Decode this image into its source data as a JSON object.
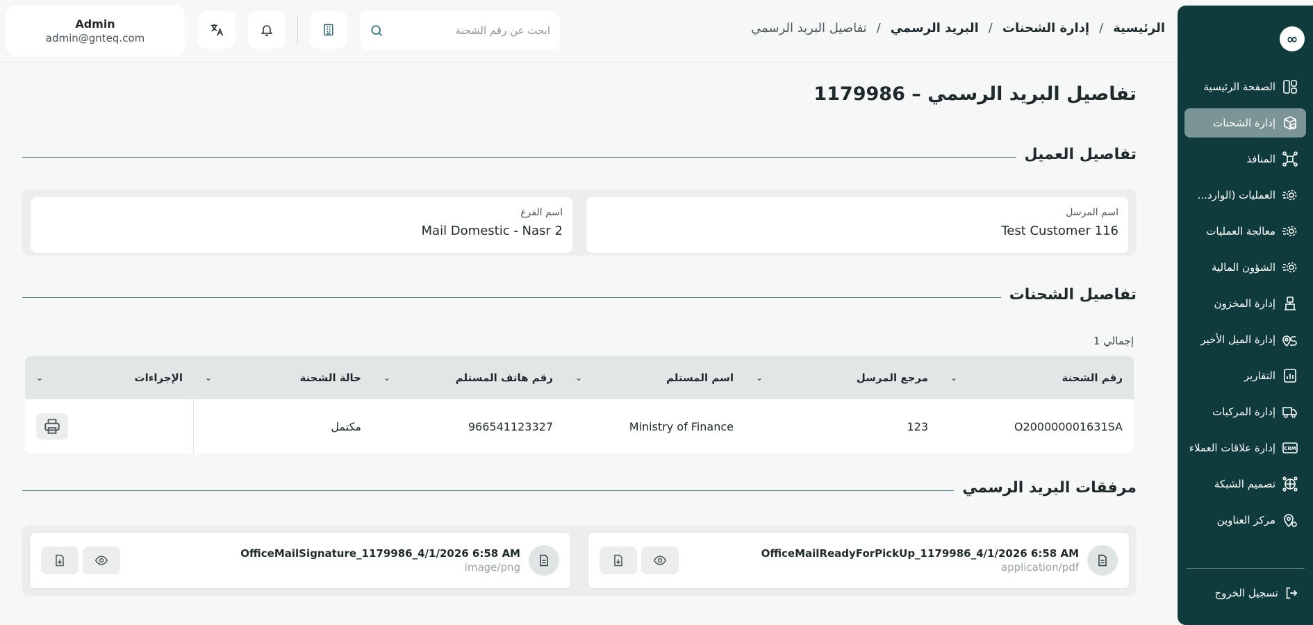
{
  "sidebar": {
    "logo_text": "∞",
    "items": [
      {
        "label": "الصفحة الرئيسية",
        "icon": "dashboard-icon"
      },
      {
        "label": "إدارة الشحنات",
        "icon": "package-icon",
        "active": true
      },
      {
        "label": "المنافذ",
        "icon": "network-icon"
      },
      {
        "label": "العمليات (الوارد...",
        "icon": "gear-icon"
      },
      {
        "label": "معالجة العمليات",
        "icon": "gear-icon"
      },
      {
        "label": "الشؤون المالية",
        "icon": "gear-icon"
      },
      {
        "label": "إدارة المخزون",
        "icon": "inventory-icon"
      },
      {
        "label": "إدارة الميل الأخير",
        "icon": "route-icon"
      },
      {
        "label": "التقارير",
        "icon": "report-icon"
      },
      {
        "label": "إدارة المركبات",
        "icon": "truck-icon"
      },
      {
        "label": "إدارة علاقات العملاء",
        "icon": "crm-icon"
      },
      {
        "label": "تصميم الشبكة",
        "icon": "network-design-icon"
      },
      {
        "label": "مركز العناوين",
        "icon": "location-icon"
      }
    ],
    "logout_label": "تسجيل الخروج"
  },
  "header": {
    "breadcrumb": [
      "الرئيسية",
      "إدارة الشحنات",
      "البريد الرسمي",
      "تفاصيل البريد الرسمي"
    ],
    "search_placeholder": "ابحث عن رقم الشحنة",
    "user": {
      "name": "Admin",
      "email": "admin@gnteq.com"
    }
  },
  "page": {
    "title": "تفاصيل البريد الرسمي – 1179986",
    "client_section": "تفاصيل العميل",
    "sender_label": "اسم المرسل",
    "sender_value": "Test Customer 116",
    "branch_label": "اسم الفرع",
    "branch_value": "Mail Domestic - Nasr 2",
    "shipments_section": "تفاصيل الشحنات",
    "total": "إجمالي 1",
    "columns": [
      "رقم الشحنة",
      "مرجع المرسل",
      "اسم المستلم",
      "رقم هاتف المستلم",
      "حالة الشحنة",
      "الإجراءات"
    ],
    "rows": [
      [
        "O200000001631SA",
        "123",
        "Ministry of Finance",
        "966541123327",
        "مكتمل"
      ]
    ],
    "attachments_section": "مرفقات البريد الرسمي",
    "attachments": [
      {
        "name": "OfficeMailReadyForPickUp_1179986_4/1/2026 6:58 AM",
        "type": "application/pdf"
      },
      {
        "name": "OfficeMailSignature_1179986_4/1/2026 6:58 AM",
        "type": "image/png"
      }
    ]
  }
}
